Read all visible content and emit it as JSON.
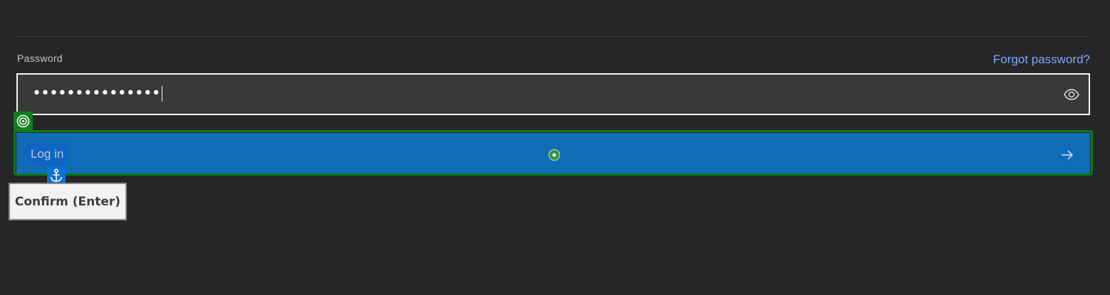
{
  "form": {
    "password_label": "Password",
    "forgot_link": "Forgot password?",
    "password_masked": "•••••••••••••••",
    "login_label": "Log in"
  },
  "overlay": {
    "tooltip": "Confirm (Enter)"
  },
  "colors": {
    "background": "#262626",
    "link": "#78a9ff",
    "button": "#0f6cb5",
    "highlight": "#0a7d16",
    "anchor_badge": "#0f6fd6"
  },
  "icons": {
    "visibility_toggle": "eye-icon",
    "submit_arrow": "arrow-right-icon",
    "target_marker": "target-icon",
    "anchor_marker": "anchor-icon",
    "click_point": "click-point-icon"
  }
}
